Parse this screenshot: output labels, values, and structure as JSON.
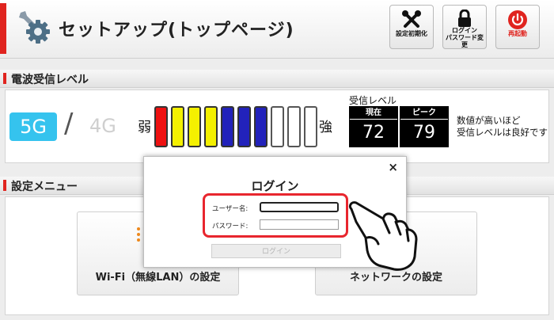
{
  "header": {
    "title": "セットアップ(トップページ)",
    "buttons": {
      "reset_label": "設定初期化",
      "login_pw_line1": "ログイン",
      "login_pw_line2": "パスワード変更",
      "restart_label": "再起動"
    },
    "icons": [
      "gear-wrench-icon",
      "tools-icon",
      "lock-icon",
      "power-icon"
    ]
  },
  "signal": {
    "section_title": "電波受信レベル",
    "band_active": "5G",
    "band_separator": "/",
    "band_inactive": "4G",
    "weak_label": "弱",
    "strong_label": "強",
    "bars": [
      {
        "color": "#ee1111",
        "filled": true
      },
      {
        "color": "#f4f000",
        "filled": true
      },
      {
        "color": "#f4f000",
        "filled": true
      },
      {
        "color": "#f4f000",
        "filled": true
      },
      {
        "color": "#2222bb",
        "filled": true
      },
      {
        "color": "#2222bb",
        "filled": true
      },
      {
        "color": "#2222bb",
        "filled": true
      },
      {
        "color": "#ffffff",
        "filled": false
      },
      {
        "color": "#ffffff",
        "filled": false
      },
      {
        "color": "#ffffff",
        "filled": false
      }
    ],
    "reception_title": "受信レベル",
    "current_label": "現在",
    "current_value": "72",
    "peak_label": "ピーク",
    "peak_value": "79",
    "note_line1": "数値が高いほど",
    "note_line2": "受信レベルは良好です"
  },
  "menu": {
    "section_title": "設定メニュー",
    "wifi_label": "Wi-Fi（無線LAN）の設定",
    "network_label": "ネットワークの設定"
  },
  "login_modal": {
    "close_symbol": "×",
    "title": "ログイン",
    "username_label": "ユーザー名:",
    "username_value": "",
    "password_label": "パスワード:",
    "password_value": "",
    "submit_label": "ログイン",
    "highlight_color": "#e8262e"
  },
  "colors": {
    "accent_red": "#e0241f",
    "band_5g": "#35c3ee"
  }
}
